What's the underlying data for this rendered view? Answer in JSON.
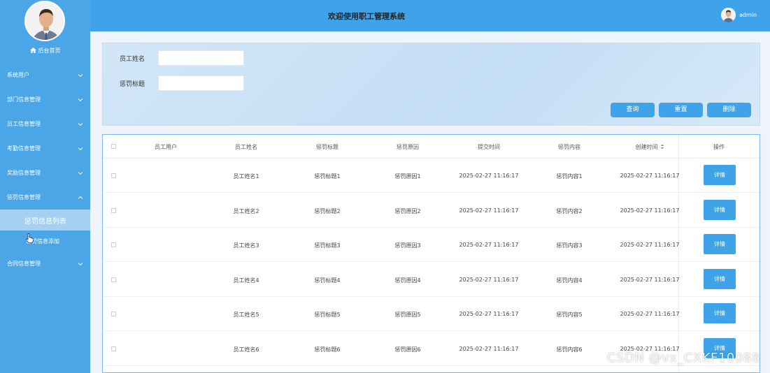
{
  "header": {
    "title": "欢迎使用职工管理系统",
    "username": "admin"
  },
  "sidebar": {
    "home_label": "后台首页",
    "items": [
      {
        "label": "系统用户",
        "expanded": false
      },
      {
        "label": "部门信息管理",
        "expanded": false
      },
      {
        "label": "员工信息管理",
        "expanded": false
      },
      {
        "label": "考勤信息管理",
        "expanded": false
      },
      {
        "label": "奖励信息管理",
        "expanded": false
      },
      {
        "label": "惩罚信息管理",
        "expanded": true,
        "children": [
          {
            "label": "惩罚信息列表",
            "active": true
          },
          {
            "label": "惩罚信息添加",
            "active": false
          }
        ]
      },
      {
        "label": "合同信息管理",
        "expanded": false
      }
    ]
  },
  "search": {
    "employee_name_label": "员工姓名",
    "employee_name_value": "",
    "punish_title_label": "惩罚标题",
    "punish_title_value": "",
    "query_label": "查询",
    "reset_label": "重置",
    "delete_label": "删除"
  },
  "table": {
    "columns": [
      "员工用户",
      "员工姓名",
      "惩罚标题",
      "惩罚原因",
      "提交时间",
      "惩罚内容",
      "创建时间",
      "操作"
    ],
    "detail_label": "详情",
    "rows": [
      {
        "user": "",
        "name": "员工姓名1",
        "title": "惩罚标题1",
        "reason": "惩罚原因1",
        "submit_time": "2025-02-27 11:16:17",
        "content": "惩罚内容1",
        "create_time": "2025-02-27 11:16:17"
      },
      {
        "user": "",
        "name": "员工姓名2",
        "title": "惩罚标题2",
        "reason": "惩罚原因2",
        "submit_time": "2025-02-27 11:16:17",
        "content": "惩罚内容2",
        "create_time": "2025-02-27 11:16:17"
      },
      {
        "user": "",
        "name": "员工姓名3",
        "title": "惩罚标题3",
        "reason": "惩罚原因3",
        "submit_time": "2025-02-27 11:16:17",
        "content": "惩罚内容3",
        "create_time": "2025-02-27 11:16:17"
      },
      {
        "user": "",
        "name": "员工姓名4",
        "title": "惩罚标题4",
        "reason": "惩罚原因4",
        "submit_time": "2025-02-27 11:16:17",
        "content": "惩罚内容4",
        "create_time": "2025-02-27 11:16:17"
      },
      {
        "user": "",
        "name": "员工姓名5",
        "title": "惩罚标题5",
        "reason": "惩罚原因5",
        "submit_time": "2025-02-27 11:16:17",
        "content": "惩罚内容5",
        "create_time": "2025-02-27 11:16:17"
      },
      {
        "user": "",
        "name": "员工姓名6",
        "title": "惩罚标题6",
        "reason": "惩罚原因6",
        "submit_time": "2025-02-27 11:16:17",
        "content": "惩罚内容6",
        "create_time": "2025-02-27 11:16:17"
      }
    ]
  },
  "watermark": "CSDN @vx_CXKF10088",
  "colors": {
    "sidebar": "#4aa6e6",
    "topbar": "#3ea3e8",
    "button": "#3ea3e8",
    "active_submenu": "#a6d0f2"
  }
}
